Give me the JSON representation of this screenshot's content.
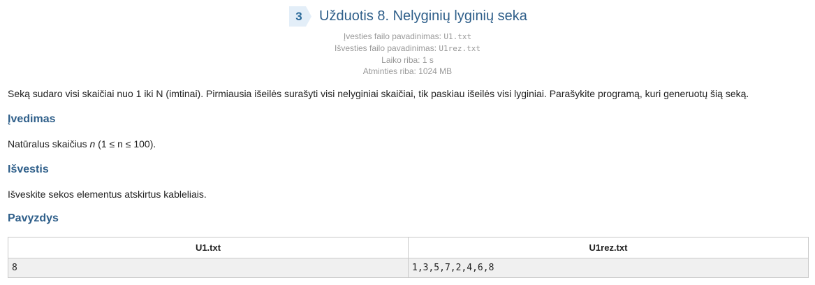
{
  "header": {
    "number": "3",
    "title": "Užduotis 8. Nelyginių lyginių seka",
    "badge_color": "#e3eef8",
    "title_color": "#2f5f8a"
  },
  "meta": {
    "input_file_label": "Įvesties failo pavadinimas:",
    "input_file_value": "U1.txt",
    "output_file_label": "Išvesties failo pavadinimas:",
    "output_file_value": "U1rez.txt",
    "time_limit": "Laiko riba: 1 s",
    "memory_limit": "Atminties riba: 1024 MB"
  },
  "body": {
    "statement": "Seką sudaro visi skaičiai nuo 1 iki N (imtinai). Pirmiausia išeilės surašyti visi nelyginiai skaičiai, tik paskiau išeilės visi lyginiai. Parašykite programą, kuri generuotų šią seką.",
    "input_heading": "Įvedimas",
    "input_text_before": "Natūralus skaičius ",
    "input_var": "n",
    "input_text_after": " (1 ≤ n ≤ 100).",
    "output_heading": "Išvestis",
    "output_text": "Išveskite sekos elementus atskirtus kableliais.",
    "example_heading": "Pavyzdys"
  },
  "example": {
    "columns": [
      "U1.txt",
      "U1rez.txt"
    ],
    "rows": [
      [
        "8",
        "1,3,5,7,2,4,6,8"
      ]
    ]
  }
}
